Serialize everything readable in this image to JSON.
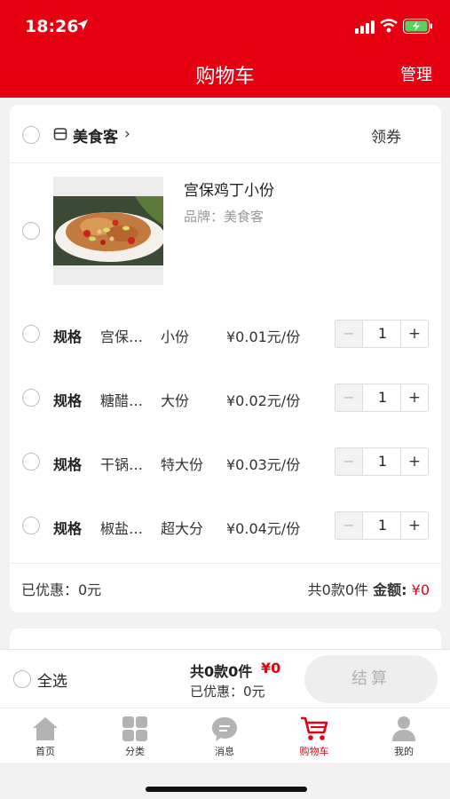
{
  "status_bar": {
    "time": "18:26"
  },
  "header": {
    "title": "购物车",
    "manage": "管理"
  },
  "shop": {
    "name": "美食客",
    "coupon": "领券"
  },
  "product": {
    "name": "宫保鸡丁小份",
    "brand_label": "品牌：",
    "brand": "美食客"
  },
  "specs": [
    {
      "label": "规格",
      "name": "宫保鸡丁",
      "size": "小份",
      "price": "¥0.01元/份",
      "qty": "1"
    },
    {
      "label": "规格",
      "name": "糖醋里脊",
      "size": "大份",
      "price": "¥0.02元/份",
      "qty": "1"
    },
    {
      "label": "规格",
      "name": "干锅花菜",
      "size": "特大份",
      "price": "¥0.03元/份",
      "qty": "1"
    },
    {
      "label": "规格",
      "name": "椒盐排条",
      "size": "超大分",
      "price": "¥0.04元/份",
      "qty": "1"
    }
  ],
  "stepper": {
    "minus": "−",
    "plus": "+"
  },
  "card_footer": {
    "discount": "已优惠：0元",
    "count": "共0款0件",
    "amount_label": "金额:",
    "amount": "¥0"
  },
  "bottom_bar": {
    "select_all": "全选",
    "count": "共0款0件",
    "amount": "¥0",
    "discount": "已优惠：0元",
    "checkout": "结算"
  },
  "tabs": [
    {
      "label": "首页",
      "icon": "home-icon"
    },
    {
      "label": "分类",
      "icon": "category-icon"
    },
    {
      "label": "消息",
      "icon": "message-icon"
    },
    {
      "label": "购物车",
      "icon": "cart-icon",
      "active": true
    },
    {
      "label": "我的",
      "icon": "user-icon"
    }
  ],
  "colors": {
    "brand": "#e60012",
    "inactive_icon": "#b3b3b3"
  }
}
